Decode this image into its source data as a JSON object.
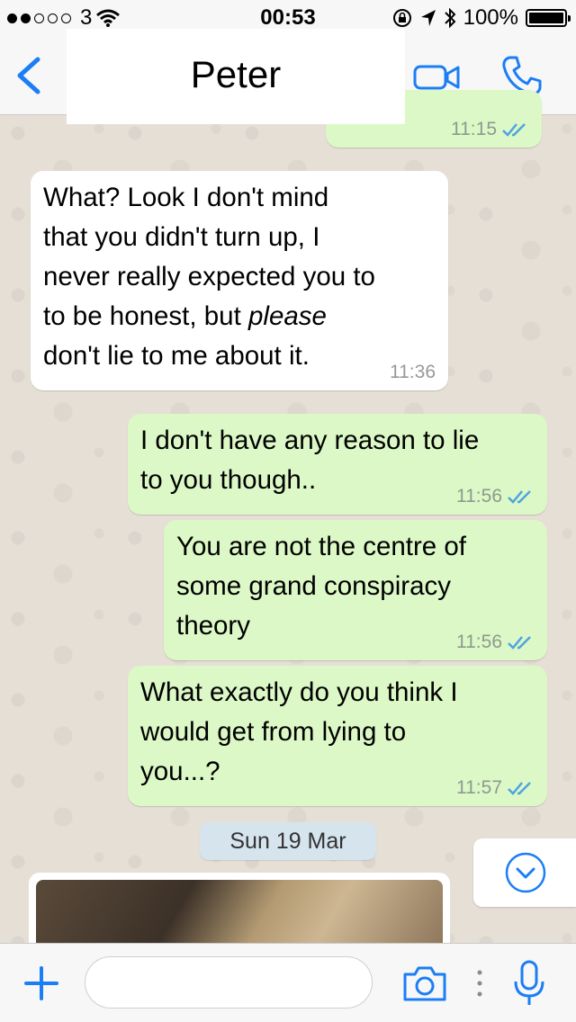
{
  "status_bar": {
    "carrier": "3",
    "time": "00:53",
    "battery": "100%"
  },
  "header": {
    "contact_name": "Peter"
  },
  "messages": [
    {
      "direction": "outgoing",
      "time": "11:15"
    },
    {
      "direction": "incoming",
      "text_pre": "What? Look I don't mind\nthat you didn't turn up, I\nnever really expected you to\nto be honest, but ",
      "text_em": "please",
      "text_post": "\ndon't lie to me about it.",
      "time": "11:36"
    },
    {
      "direction": "outgoing",
      "text": "I don't have any reason to lie\nto you though..",
      "time": "11:56"
    },
    {
      "direction": "outgoing",
      "text": "You are not the centre of\nsome grand conspiracy\ntheory",
      "time": "11:56"
    },
    {
      "direction": "outgoing",
      "text": "What exactly do you think I\nwould get from lying to\nyou...?",
      "time": "11:57"
    }
  ],
  "date_divider": "Sun 19 Mar",
  "composer": {
    "placeholder": ""
  },
  "colors": {
    "accent": "#1b7ef5",
    "outgoing_bubble": "#dcf8c6",
    "incoming_bubble": "#ffffff",
    "read_ticks": "#4fa3e0",
    "wallpaper": "#e6dfd6"
  },
  "icons": [
    "back-icon",
    "video-call-icon",
    "phone-icon",
    "read-ticks-icon",
    "chevron-down-icon",
    "plus-icon",
    "camera-icon",
    "microphone-icon"
  ]
}
